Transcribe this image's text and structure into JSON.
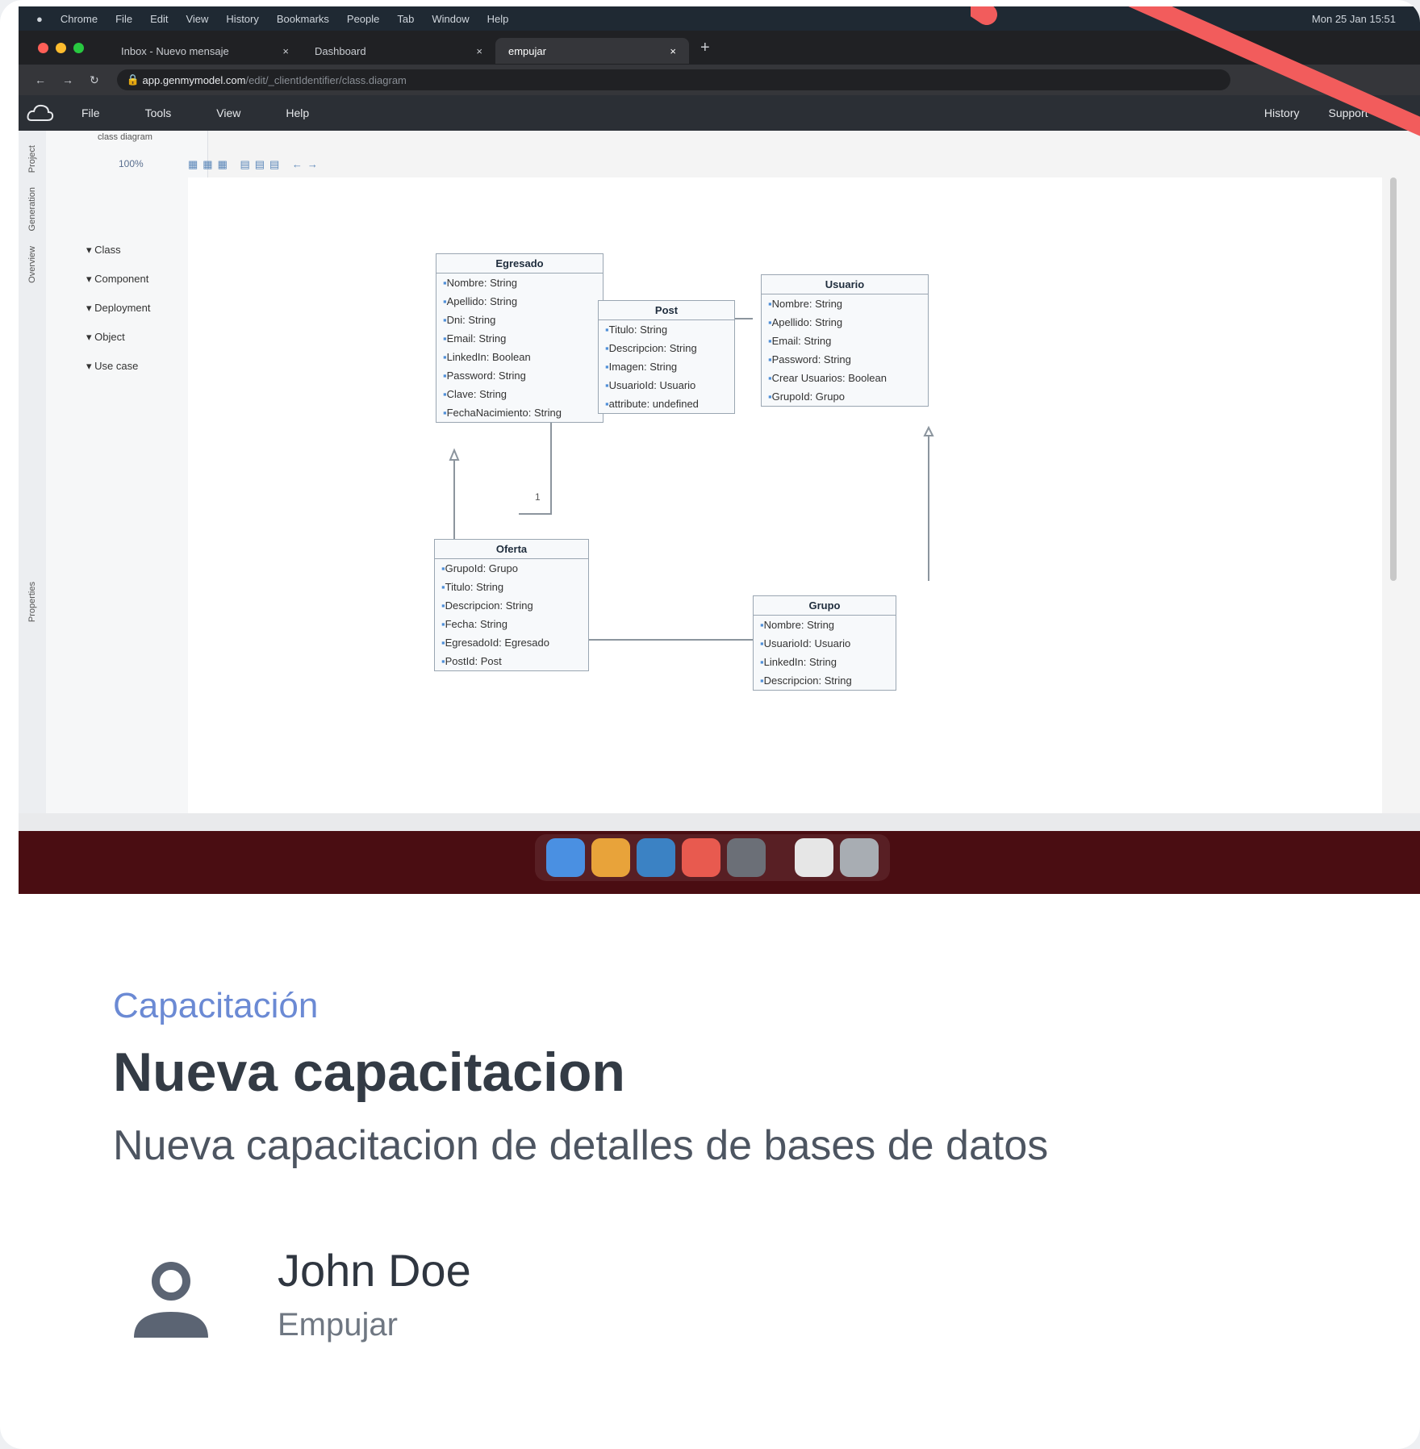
{
  "mac_menu": {
    "items": [
      "Chrome",
      "File",
      "Edit",
      "View",
      "History",
      "Bookmarks",
      "People",
      "Tab",
      "Window",
      "Help"
    ],
    "clock": "Mon 25 Jan 15:51"
  },
  "browser": {
    "tabs": [
      {
        "label": "Inbox - Nuevo mensaje"
      },
      {
        "label": "Dashboard"
      },
      {
        "label": "empujar"
      }
    ],
    "url_host": "app.genmymodel.com",
    "url_path": "/edit/_clientIdentifier/class.diagram"
  },
  "app": {
    "menu": [
      "File",
      "Tools",
      "View",
      "Help"
    ],
    "right_menu": [
      "History",
      "Support"
    ],
    "doc_tab": "class diagram",
    "zoom": "100%",
    "palette": [
      "Class",
      "Component",
      "Deployment",
      "Object",
      "Use case"
    ],
    "side_rail": [
      "Project",
      "Generation",
      "Overview",
      "Properties"
    ]
  },
  "diagram": {
    "classes": [
      {
        "name": "Egresado",
        "attrs": [
          "Nombre: String",
          "Apellido: String",
          "Dni: String",
          "Email: String",
          "LinkedIn: Boolean",
          "Password: String",
          "Clave: String",
          "FechaNacimiento: String"
        ]
      },
      {
        "name": "Post",
        "attrs": [
          "Titulo: String",
          "Descripcion: String",
          "Imagen: String",
          "UsuarioId: Usuario",
          "attribute: undefined"
        ]
      },
      {
        "name": "Usuario",
        "attrs": [
          "Nombre: String",
          "Apellido: String",
          "Email: String",
          "Password: String",
          "Crear Usuarios: Boolean",
          "GrupoId: Grupo"
        ]
      },
      {
        "name": "Oferta",
        "attrs": [
          "GrupoId: Grupo",
          "Titulo: String",
          "Descripcion: String",
          "Fecha: String",
          "EgresadoId: Egresado",
          "PostId: Post"
        ]
      },
      {
        "name": "Grupo",
        "attrs": [
          "Nombre: String",
          "UsuarioId: Usuario",
          "LinkedIn: String",
          "Descripcion: String"
        ]
      }
    ],
    "multiplicity": [
      "1",
      "1"
    ]
  },
  "content": {
    "breadcrumb": "Capacitación",
    "title": "Nueva capacitacion",
    "subtitle": "Nueva capacitacion de detalles de bases de datos",
    "author_name": "John Doe",
    "author_role": "Empujar"
  },
  "colors": {
    "accent": "#6b8ad4",
    "annotation_arrow": "#f25c5c",
    "dock_bg": "#4a0d12"
  }
}
